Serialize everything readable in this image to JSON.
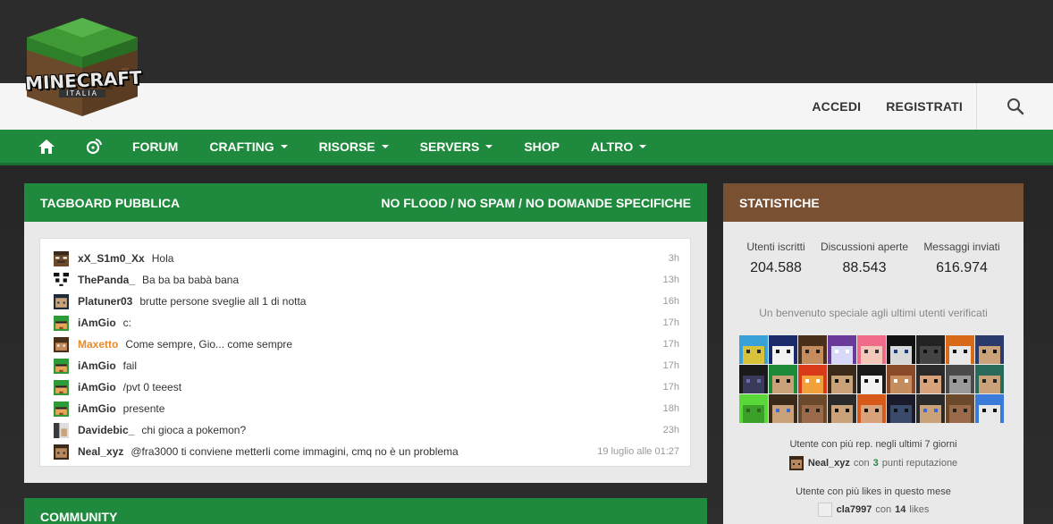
{
  "header": {
    "logo_text": "MINECRAFT",
    "logo_sub": "ITALIA",
    "login_label": "ACCEDI",
    "register_label": "REGISTRATI"
  },
  "nav": {
    "items": [
      {
        "label": "FORUM",
        "dropdown": false
      },
      {
        "label": "CRAFTING",
        "dropdown": true
      },
      {
        "label": "RISORSE",
        "dropdown": true
      },
      {
        "label": "SERVERS",
        "dropdown": true
      },
      {
        "label": "SHOP",
        "dropdown": false
      },
      {
        "label": "ALTRO",
        "dropdown": true
      }
    ]
  },
  "tagboard": {
    "title": "TAGBOARD PUBBLICA",
    "rules": "NO FLOOD / NO SPAM / NO DOMANDE SPECIFICHE",
    "messages": [
      {
        "user": "xX_S1m0_Xx",
        "text": "Hola",
        "time": "3h"
      },
      {
        "user": "ThePanda_",
        "text": "Ba ba ba babà bana",
        "time": "13h"
      },
      {
        "user": "Platuner03",
        "text": "brutte persone sveglie all 1 di notta",
        "time": "16h"
      },
      {
        "user": "iAmGio",
        "text": "c:",
        "time": "17h"
      },
      {
        "user": "Maxetto",
        "text": "Come sempre, Gio... come sempre",
        "time": "17h"
      },
      {
        "user": "iAmGio",
        "text": "fail",
        "time": "17h"
      },
      {
        "user": "iAmGio",
        "text": "/pvt 0 teeest",
        "time": "17h"
      },
      {
        "user": "iAmGio",
        "text": "presente",
        "time": "18h"
      },
      {
        "user": "Davidebic_",
        "text": "chi gioca a pokemon?",
        "time": "23h"
      },
      {
        "user": "Neal_xyz",
        "text": "@fra3000 ti conviene metterli come immagini, cmq no è un problema",
        "time": "19 luglio alle 01:27"
      }
    ]
  },
  "community": {
    "title": "COMMUNITY"
  },
  "stats": {
    "title": "STATISTICHE",
    "members_label": "Utenti iscritti",
    "members_value": "204.588",
    "threads_label": "Discussioni aperte",
    "threads_value": "88.543",
    "posts_label": "Messaggi inviati",
    "posts_value": "616.974",
    "welcome": "Un benvenuto speciale agli ultimi utenti verificati",
    "rep_label": "Utente con più rep. negli ultimi 7 giorni",
    "rep_user": "Neal_xyz",
    "rep_with": "con",
    "rep_count": "3",
    "rep_suffix": "punti reputazione",
    "likes_label": "Utente con più likes in questo mese",
    "likes_user": "cla7997",
    "likes_with": "con",
    "likes_count": "14",
    "likes_suffix": "likes"
  },
  "colors": {
    "brand_green": "#1f8a3d",
    "stats_brown": "#7a5033",
    "highlight_orange": "#e58a2d"
  }
}
